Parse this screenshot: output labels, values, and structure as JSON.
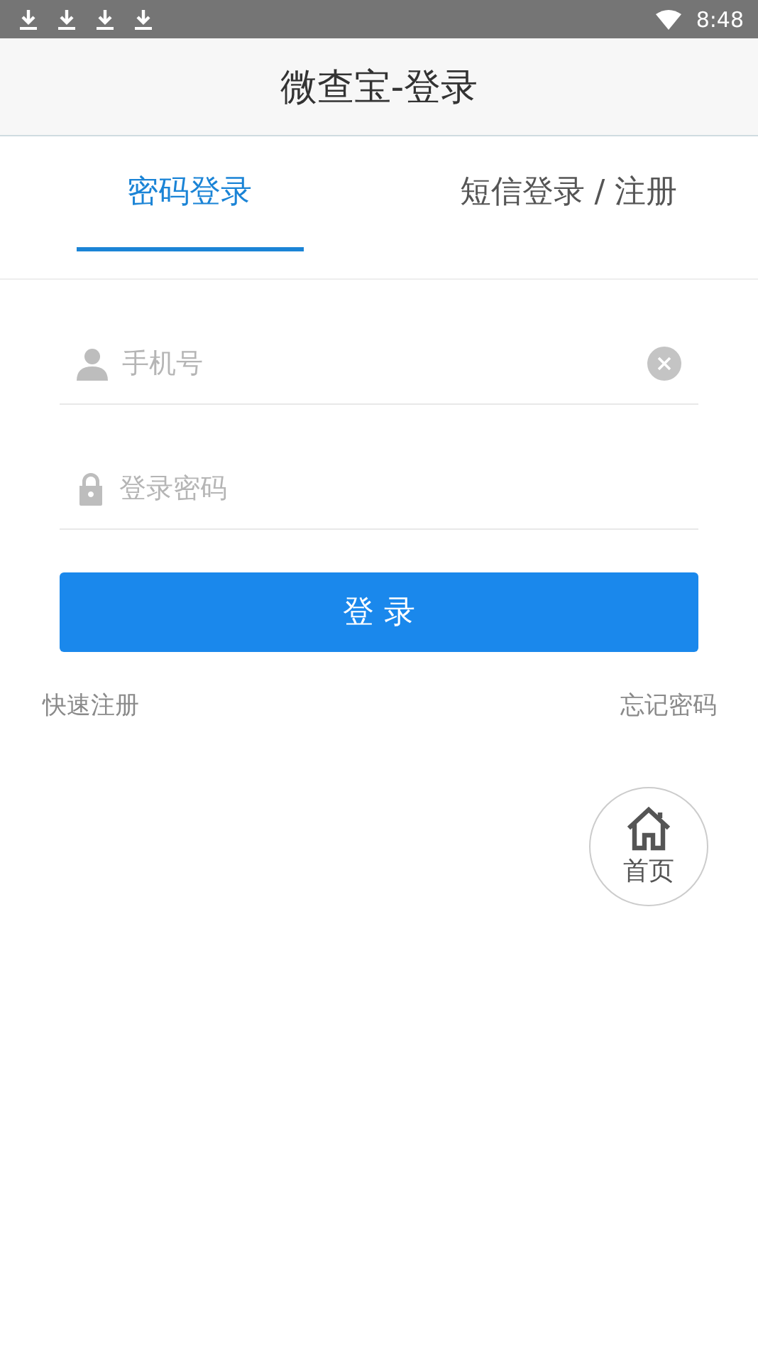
{
  "status_bar": {
    "notifications": [
      {
        "kind": "download"
      },
      {
        "kind": "download"
      },
      {
        "kind": "download"
      },
      {
        "kind": "download"
      }
    ],
    "time": "8:48"
  },
  "header": {
    "title": "微查宝-登录"
  },
  "tabs": [
    {
      "label": "密码登录",
      "selected": true
    },
    {
      "label": "短信登录 / 注册",
      "selected": false
    }
  ],
  "fields": [
    {
      "kind": "phone",
      "placeholder": "手机号",
      "clearable": true
    },
    {
      "kind": "password",
      "placeholder": "登录密码",
      "clearable": false
    }
  ],
  "login_button": {
    "label": "登 录"
  },
  "links": [
    "快速注册",
    "忘记密码"
  ],
  "home_button": {
    "label": "首页"
  }
}
